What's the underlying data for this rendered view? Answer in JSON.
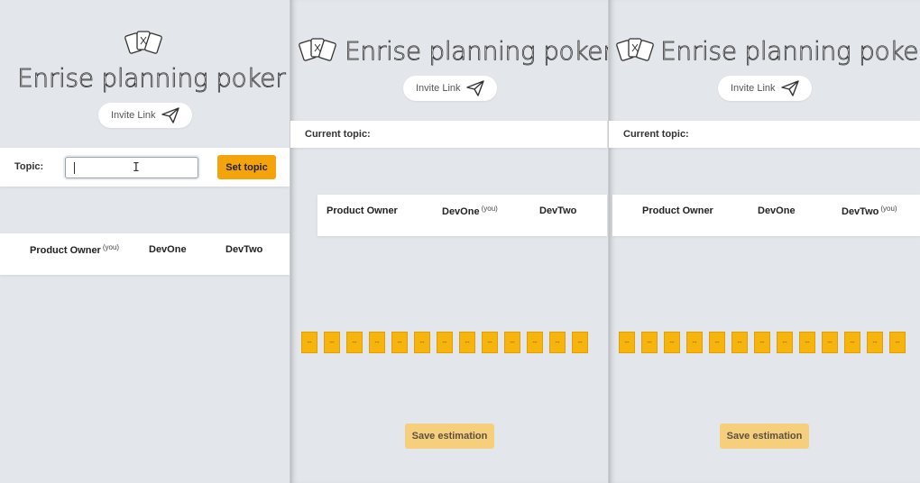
{
  "app_title": "Enrise planning poker",
  "invite_label": "Invite Link",
  "topic_label": "Topic:",
  "topic_input_value": "",
  "set_topic_label": "Set topic",
  "current_topic_label": "Current topic:",
  "you_tag": "(you)",
  "players": [
    "Product Owner",
    "DevOne",
    "DevTwo"
  ],
  "card_values": [
    "--",
    "--",
    "--",
    "--",
    "--",
    "--",
    "--",
    "--",
    "--",
    "--",
    "--",
    "--",
    "--"
  ],
  "save_label": "Save estimation",
  "colors": {
    "accent": "#f5a30a",
    "card": "#f6b40c",
    "save_disabled": "#f6cf7c",
    "background": "#e3e6ea"
  }
}
